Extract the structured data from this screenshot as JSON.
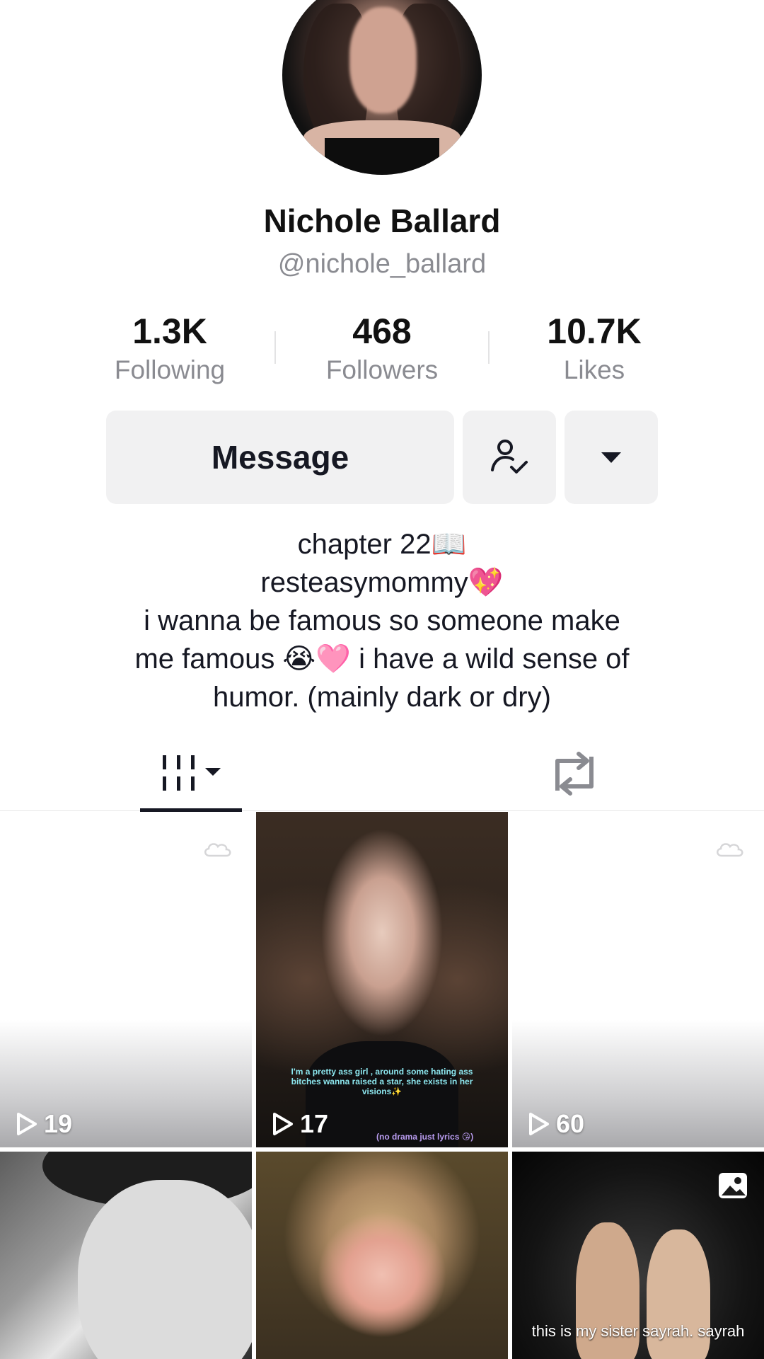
{
  "profile": {
    "display_name": "Nichole Ballard",
    "handle": "@nichole_ballard"
  },
  "stats": [
    {
      "value": "1.3K",
      "label": "Following"
    },
    {
      "value": "468",
      "label": "Followers"
    },
    {
      "value": "10.7K",
      "label": "Likes"
    }
  ],
  "actions": {
    "message_label": "Message",
    "follow_icon": "user-check-icon",
    "more_icon": "caret-down-icon"
  },
  "bio": [
    "chapter 22📖",
    "resteasymommy💖",
    "i wanna be famous so someone make",
    "me famous 😭🩷 i have a wild sense of",
    "humor. (mainly dark or dry)"
  ],
  "tabs": {
    "videos_icon": "grid-icon",
    "reposts_icon": "repost-icon"
  },
  "videos": [
    {
      "views": "19"
    },
    {
      "views": "17",
      "caption": "I'm a pretty ass girl , around some hating ass bitches wanna raised a star, she exists in her visions✨",
      "caption_tag": "(no drama just lyrics 😘)"
    },
    {
      "views": "60"
    },
    {
      "views": ""
    },
    {
      "views": ""
    },
    {
      "views": "",
      "caption": "this is my sister sayrah. sayrah"
    }
  ],
  "colors": {
    "text_primary": "#161823",
    "text_secondary": "#8a8b91",
    "button_bg": "#f1f1f2"
  }
}
